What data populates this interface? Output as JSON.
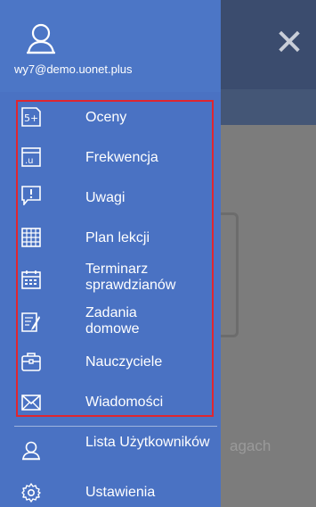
{
  "background": {
    "partial_text": "agach",
    "close_icon": "close-icon"
  },
  "drawer": {
    "email": "wy7@demo.uonet.plus",
    "items": [
      {
        "label": "Oceny",
        "icon": "grades-icon"
      },
      {
        "label": "Frekwencja",
        "icon": "attendance-icon"
      },
      {
        "label": "Uwagi",
        "icon": "notes-icon"
      },
      {
        "label": "Plan lekcji",
        "icon": "timetable-icon"
      },
      {
        "label": "Terminarz sprawdzianów",
        "icon": "exams-calendar-icon"
      },
      {
        "label": "Zadania domowe",
        "icon": "homework-icon"
      },
      {
        "label": "Nauczyciele",
        "icon": "teachers-icon"
      },
      {
        "label": "Wiadomości",
        "icon": "messages-icon"
      }
    ],
    "bottom_items": [
      {
        "label": "Lista Użytkowników",
        "icon": "users-icon"
      },
      {
        "label": "Ustawienia",
        "icon": "settings-icon"
      }
    ]
  },
  "colors": {
    "drawer_bg": "#4a72c3",
    "highlight_border": "#e0262f"
  }
}
